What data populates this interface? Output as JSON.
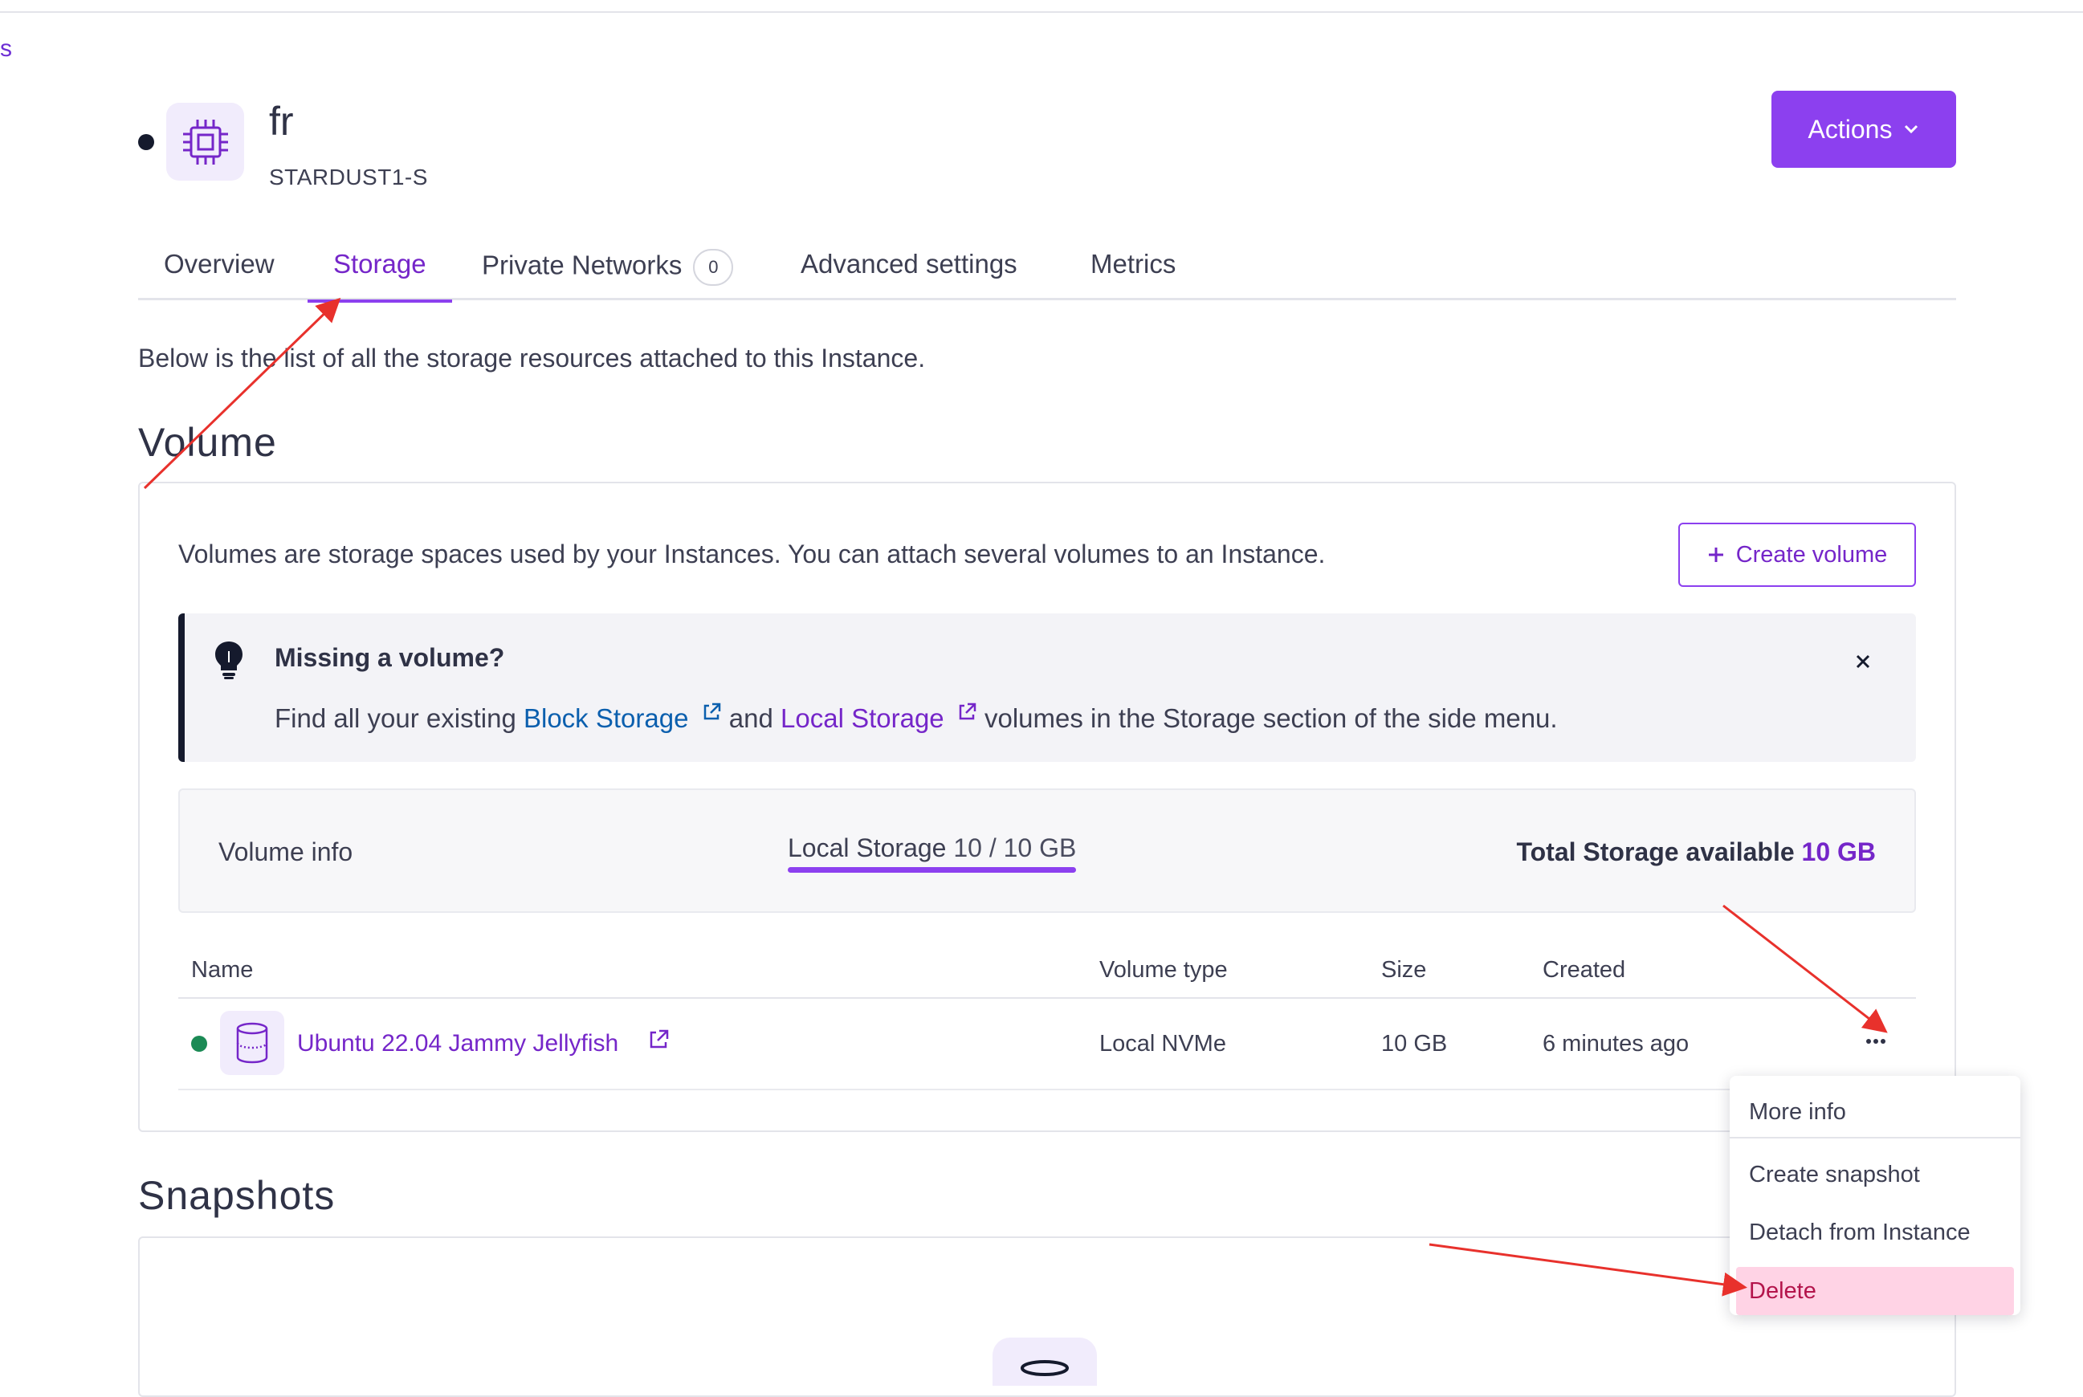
{
  "edge_link": "s",
  "instance": {
    "name": "fr",
    "type": "STARDUST1-S",
    "actions_label": "Actions"
  },
  "tabs": [
    {
      "label": "Overview"
    },
    {
      "label": "Storage",
      "active": true
    },
    {
      "label": "Private Networks",
      "count": "0"
    },
    {
      "label": "Advanced settings"
    },
    {
      "label": "Metrics"
    }
  ],
  "intro": "Below is the list of all the storage resources attached to this Instance.",
  "volume": {
    "heading": "Volume",
    "description": "Volumes are storage spaces used by your Instances. You can attach several volumes to an Instance.",
    "create_label": "Create volume",
    "alert": {
      "title": "Missing a volume?",
      "text_1": "Find all your existing ",
      "link_1": "Block Storage",
      "text_2": " and ",
      "link_2": "Local Storage",
      "text_3": " volumes in the Storage section of the side menu."
    },
    "info": {
      "label": "Volume info",
      "local_label": "Local Storage",
      "local_value": "10 / 10 GB",
      "local_fill": 1.0,
      "total_label": "Total Storage available",
      "total_value": "10 GB"
    },
    "table": {
      "headers": [
        "Name",
        "Volume type",
        "Size",
        "Created"
      ],
      "rows": [
        {
          "name": "Ubuntu 22.04 Jammy Jellyfish",
          "type": "Local NVMe",
          "size": "10 GB",
          "created": "6 minutes ago",
          "status_color": "#1b8a55"
        }
      ]
    },
    "menu": [
      "More info",
      "Create snapshot",
      "Detach from Instance",
      "Delete"
    ]
  },
  "snapshots": {
    "heading": "Snapshots"
  },
  "colors": {
    "accent": "#8c40ef",
    "link": "#7526c9",
    "block_link": "#0b5fae",
    "danger_bg": "#ffd3e5",
    "annotation_arrow": "#e8312c"
  }
}
